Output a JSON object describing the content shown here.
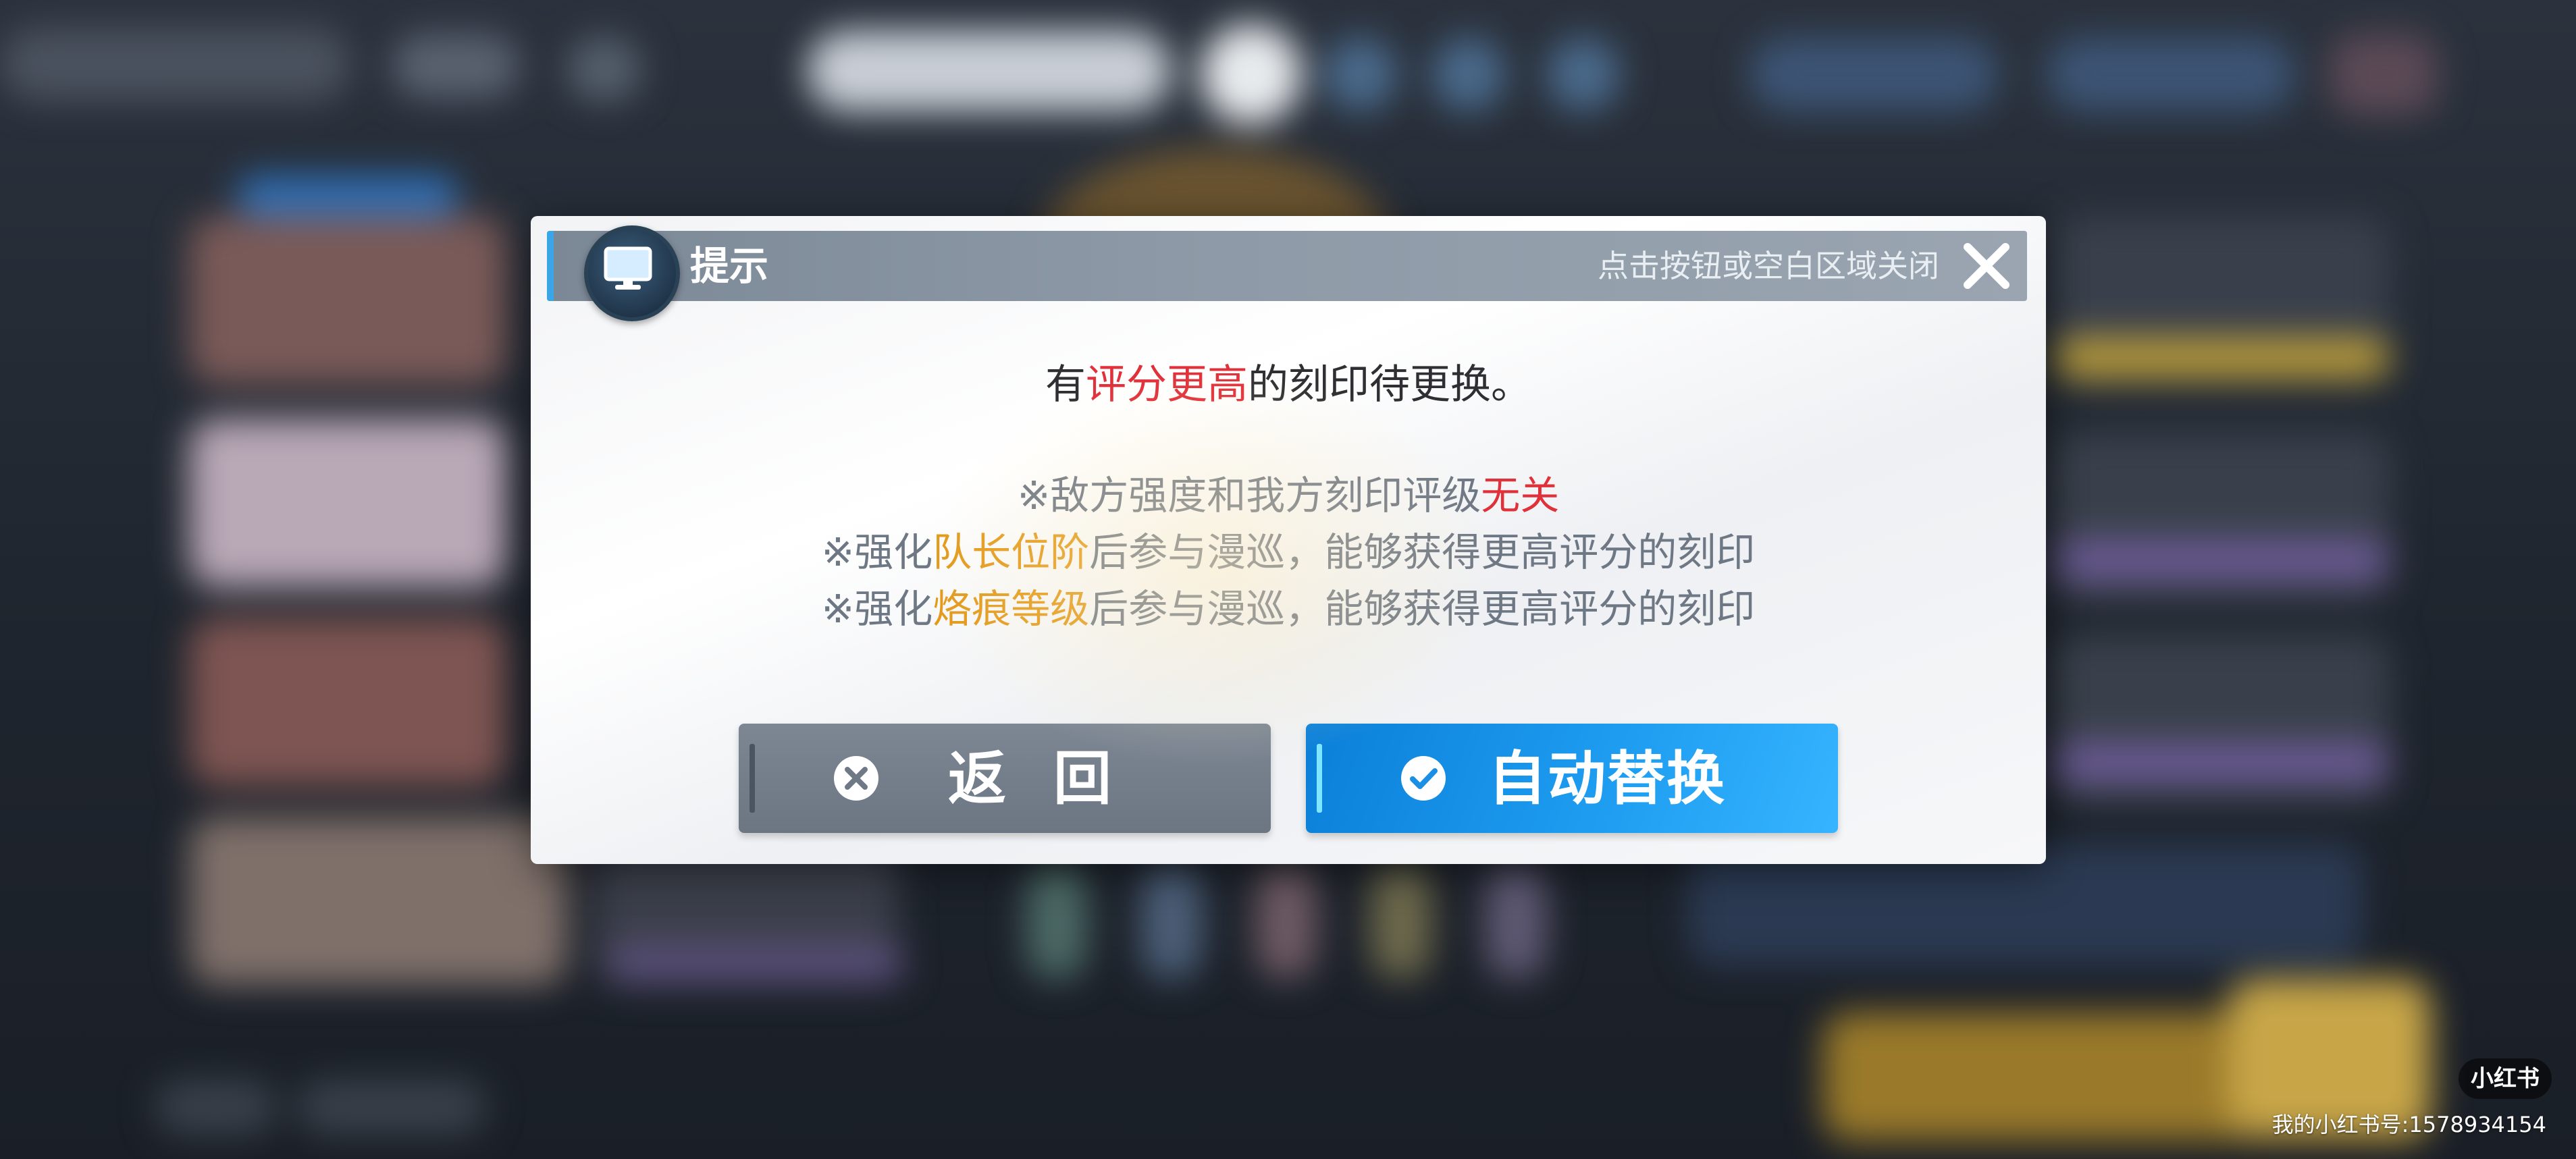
{
  "dialog": {
    "title": "提示",
    "close_hint": "点击按钮或空白区域关闭",
    "message": {
      "prefix": "有",
      "highlight": "评分更高",
      "suffix": "的刻印待更换。"
    },
    "notes": [
      {
        "prefix": "※敌方强度和我方刻印评级",
        "highlight": "无关",
        "suffix": ""
      },
      {
        "prefix": "※强化",
        "highlight": "队长位阶",
        "suffix": "后参与漫巡，能够获得更高评分的刻印"
      },
      {
        "prefix": "※强化",
        "highlight": "烙痕等级",
        "suffix": "后参与漫巡，能够获得更高评分的刻印"
      }
    ],
    "buttons": {
      "back_label": "返回",
      "auto_label": "自动替换"
    }
  },
  "watermark": {
    "logo": "小红书",
    "account": "我的小红书号:1578934154"
  },
  "icons": {
    "title_icon": "monitor-icon",
    "close": "close-icon",
    "back": "x-circle-icon",
    "auto": "check-circle-icon"
  },
  "colors": {
    "highlight_red": "#e0303a",
    "highlight_orange": "#e39a1c",
    "primary_button": "#1d9cf0",
    "secondary_button": "#737d8a",
    "title_bar": "#8e9aa7"
  }
}
